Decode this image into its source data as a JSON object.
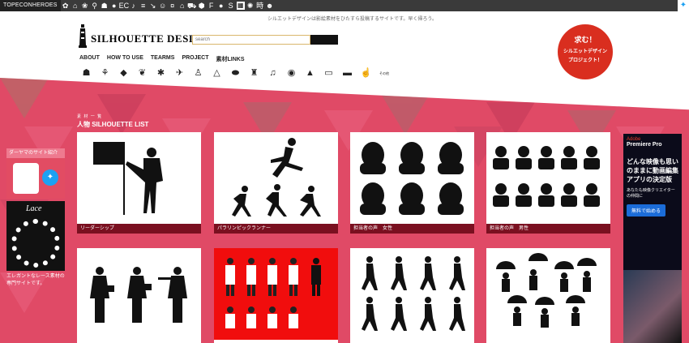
{
  "topbar": {
    "brand": "TOPECONHEROES",
    "icons": [
      "gear-icon",
      "home-icon",
      "flower-icon",
      "pin-icon",
      "chat-icon",
      "bubble-icon",
      "ec-icon",
      "music-icon",
      "text-icon",
      "arrow-icon",
      "text-icon",
      "emoji-icon",
      "symbol-icon",
      "shop-icon",
      "font-icon",
      "car-icon",
      "hexagon-icon",
      "f-icon",
      "apple-icon",
      "s-icon",
      "grid-icon",
      "sun-icon",
      "clock-icon",
      "doll-icon"
    ],
    "ec_label": "EC",
    "f_label": "F",
    "s_label": "S",
    "clock_label": "時"
  },
  "header": {
    "tagline": "シルエットデザインは影絵素材をひたすら投稿するサイトです。早く帰ろう。",
    "logo_text": "SILHOUETTE DESIGN",
    "search_placeholder": "search",
    "nav": [
      "ABOUT",
      "HOW TO USE",
      "TEARMS",
      "PROJECT",
      "素材LINKS"
    ],
    "categories": [
      "person-icon",
      "running-icon",
      "fish-icon",
      "leaf-icon",
      "bug-icon",
      "plane-icon",
      "meditate-icon",
      "tent-icon",
      "pill-icon",
      "jacket-icon",
      "music-note-icon",
      "eye-icon",
      "mountain-icon",
      "laptop-icon",
      "burger-icon",
      "hand-icon"
    ],
    "categories_more": "その他"
  },
  "badge": {
    "line1": "求む！",
    "line2": "シルエットデザイン",
    "line3": "プロジェクト！"
  },
  "section": {
    "subtitle": "素 材 一 覧",
    "title": "人物 SILHOUETTE LIST"
  },
  "cards": [
    {
      "caption": "リーダーシップ"
    },
    {
      "caption": "パラリンピックランナー"
    },
    {
      "caption": "担当者の声　女性"
    },
    {
      "caption": "担当者の声　男性"
    },
    {
      "caption": ""
    },
    {
      "caption": ""
    },
    {
      "caption": ""
    },
    {
      "caption": ""
    }
  ],
  "sidebar": {
    "heading": "ダーヤマのサイト紹介",
    "lace_title": "Lace",
    "lace_desc": "エレガントなレース素材の専門サイトです。"
  },
  "ad": {
    "brand": "Adobe",
    "product": "Premiere Pro",
    "headline": "どんな映像も思いのままに動画編集アプリの決定版",
    "sub": "あなたも映像クリエイターの仲間に",
    "button": "無料で始める"
  },
  "colors": {
    "accent_pink": "#e04a66",
    "caption_bg": "#7a1020",
    "badge_red": "#d92e1f"
  }
}
